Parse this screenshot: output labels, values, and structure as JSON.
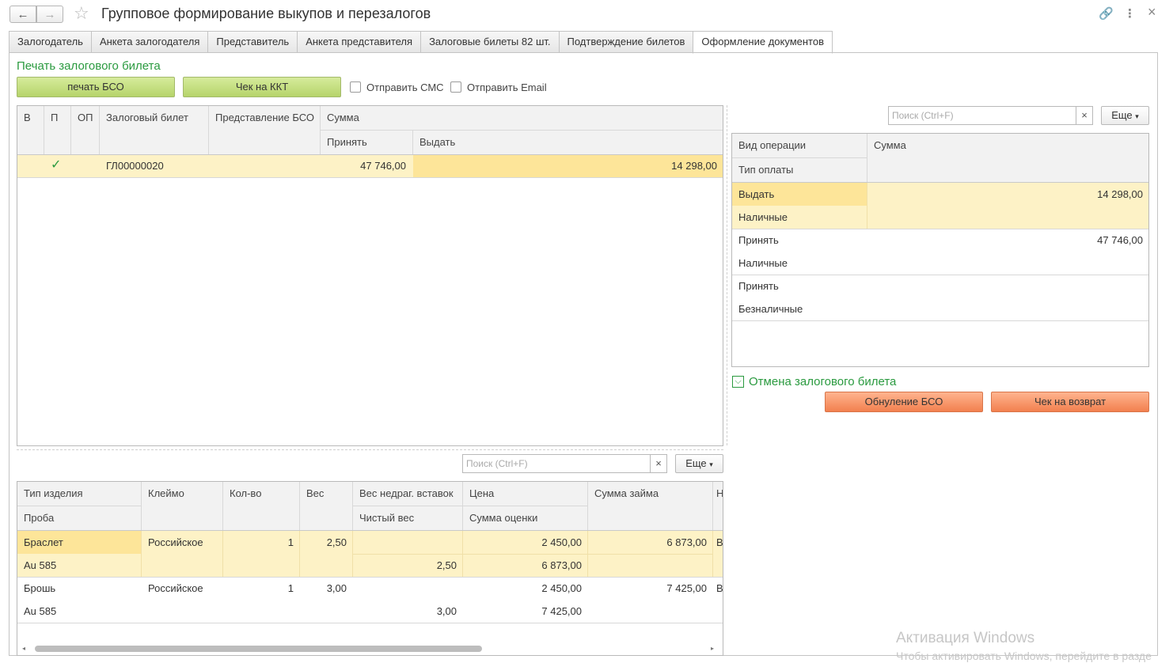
{
  "window": {
    "title": "Групповое формирование выкупов и перезалогов",
    "back_icon": "←",
    "forward_icon": "→",
    "star_icon": "☆",
    "link_icon": "🔗",
    "menu_icon": "⋮",
    "close_icon": "×"
  },
  "tabs": [
    {
      "label": "Залогодатель"
    },
    {
      "label": "Анкета залогодателя"
    },
    {
      "label": "Представитель"
    },
    {
      "label": "Анкета представителя"
    },
    {
      "label": "Залоговые билеты 82 шт."
    },
    {
      "label": "Подтверждение билетов"
    },
    {
      "label": "Оформление документов"
    }
  ],
  "print_section": {
    "title": "Печать залогового билета",
    "print_bso_label": "печать БСО",
    "kkt_label": "Чек на ККТ",
    "send_sms_label": "Отправить СМС",
    "send_email_label": "Отправить Email"
  },
  "tickets_table": {
    "headers": {
      "v": "В",
      "p": "П",
      "op": "ОП",
      "ticket": "Залоговый билет",
      "bso": "Представление БСО",
      "sum": "Сумма",
      "accept": "Принять",
      "issue": "Выдать"
    },
    "rows": [
      {
        "check": "✓",
        "ticket": "ГЛ00000020",
        "bso": "",
        "accept": "47 746,00",
        "issue": "14 298,00"
      }
    ]
  },
  "right_search": {
    "placeholder": "Поиск (Ctrl+F)",
    "clear": "×",
    "more_label": "Еще"
  },
  "ops_table": {
    "headers": {
      "op_type": "Вид операции",
      "pay_type": "Тип оплаты",
      "sum": "Сумма"
    },
    "rows": [
      {
        "op": "Выдать",
        "pay": "Наличные",
        "sum": "14 298,00"
      },
      {
        "op": "Принять",
        "pay": "Наличные",
        "sum": "47 746,00"
      },
      {
        "op": "Принять",
        "pay": "Безналичные",
        "sum": ""
      }
    ]
  },
  "cancel_section": {
    "title": "Отмена залогового билета",
    "reset_bso_label": "Обнуление БСО",
    "refund_label": "Чек на возврат"
  },
  "items_search": {
    "placeholder": "Поиск (Ctrl+F)",
    "clear": "×",
    "more_label": "Еще"
  },
  "items_table": {
    "headers": {
      "item_type": "Тип изделия",
      "assay": "Проба",
      "hallmark": "Клеймо",
      "qty": "Кол-во",
      "weight": "Вес",
      "insert_weight": "Вес недраг. вставок",
      "net_weight": "Чистый вес",
      "price": "Цена",
      "appraisal": "Сумма оценки",
      "loan": "Сумма займа",
      "extra": "Н"
    },
    "rows": [
      {
        "item_type": "Браслет",
        "assay": "Au 585",
        "hallmark": "Российское",
        "qty": "1",
        "weight": "2,50",
        "net_weight": "2,50",
        "price": "2 450,00",
        "appraisal": "6 873,00",
        "loan": "6 873,00",
        "extra": "В"
      },
      {
        "item_type": "Брошь",
        "assay": "Au 585",
        "hallmark": "Российское",
        "qty": "1",
        "weight": "3,00",
        "net_weight": "3,00",
        "price": "2 450,00",
        "appraisal": "7 425,00",
        "loan": "7 425,00",
        "extra": "В"
      }
    ]
  },
  "watermark": {
    "line1": "Активация Windows",
    "line2": "Чтобы активировать Windows, перейдите в разде"
  }
}
